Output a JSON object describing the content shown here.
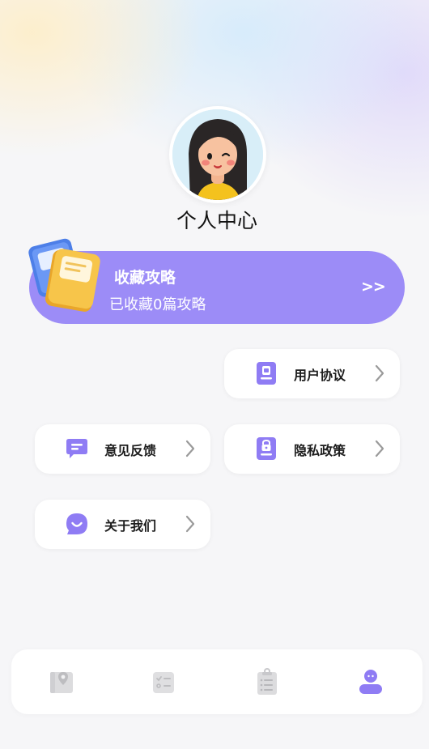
{
  "header": {
    "title": "个人中心"
  },
  "favorites": {
    "title": "收藏攻略",
    "subtitle": "已收藏0篇攻略",
    "arrow": ">>"
  },
  "menu": {
    "user_agreement": "用户协议",
    "feedback": "意见反馈",
    "privacy_policy": "隐私政策",
    "about_us": "关于我们"
  },
  "tabbar": {
    "items": [
      {
        "icon": "map-pin-icon",
        "active": false
      },
      {
        "icon": "checklist-icon",
        "active": false
      },
      {
        "icon": "clipboard-icon",
        "active": false
      },
      {
        "icon": "user-icon",
        "active": true
      }
    ]
  },
  "colors": {
    "accent": "#9c8cf7",
    "icon_purple": "#8f7cf4",
    "inactive_icon": "#d7d7d9",
    "background": "#f6f6f8"
  }
}
